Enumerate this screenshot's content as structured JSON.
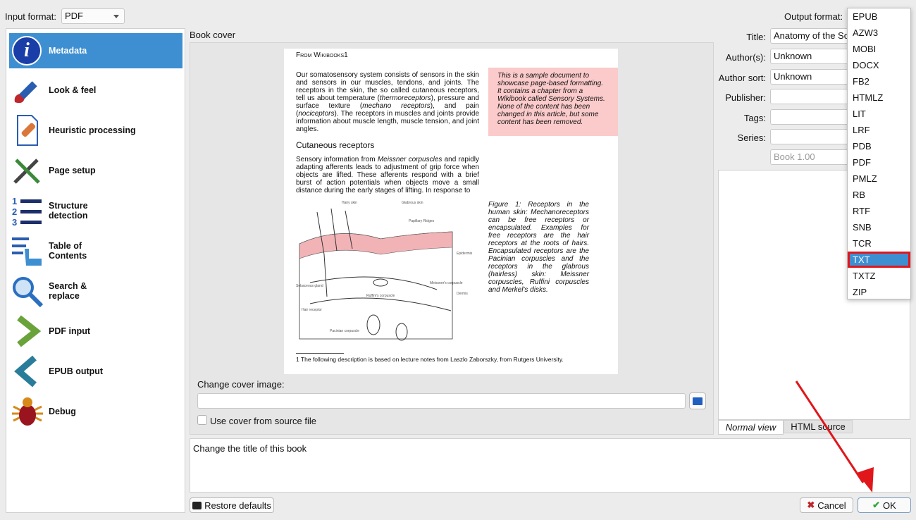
{
  "top": {
    "input_format_label": "Input format:",
    "input_format_value": "PDF",
    "output_format_label": "Output format:"
  },
  "sidebar": {
    "items": [
      {
        "label": "Metadata",
        "icon": "info-icon",
        "selected": true
      },
      {
        "label": "Look & feel",
        "icon": "paintbrush-icon"
      },
      {
        "label": "Heuristic processing",
        "icon": "bandage-document-icon"
      },
      {
        "label": "Page setup",
        "icon": "tools-icon"
      },
      {
        "label": "Structure detection",
        "icon": "numbered-list-icon"
      },
      {
        "label": "Table of Contents",
        "icon": "toc-hand-icon"
      },
      {
        "label": "Search & replace",
        "icon": "magnifier-icon"
      },
      {
        "label": "PDF input",
        "icon": "chevron-right-icon"
      },
      {
        "label": "EPUB output",
        "icon": "chevron-left-icon"
      },
      {
        "label": "Debug",
        "icon": "bug-icon"
      }
    ]
  },
  "cover": {
    "heading": "Book cover",
    "page": {
      "header": "From Wikibooks1",
      "para1_a": "Our somatosensory system consists of sensors in the skin and sensors in our muscles, tendons, and joints. The receptors in the skin, the so called cutaneous receptors, tell us about temperature (",
      "para1_i1": "thermoreceptors",
      "para1_b": "), pressure and surface texture (",
      "para1_i2": "mechano receptors",
      "para1_c": "), and pain (",
      "para1_i3": "nociceptors",
      "para1_d": "). The receptors in muscles and joints provide information about muscle length, muscle tension, and joint angles.",
      "note": "This is a sample document to showcase page-based formatting. It contains a chapter from a Wikibook called Sensory Systems. None of the content has been changed in this article, but some content has been removed.",
      "subheading": "Cutaneous receptors",
      "para2_a": "Sensory information from ",
      "para2_i": "Meissner corpuscles",
      "para2_b": " and rapidly adapting afferents leads to adjustment of grip force when objects are lifted. These afferents respond with a brief burst of action potentials when objects move a small distance during the early stages of lifting. In response to",
      "caption": "Figure 1: Receptors in the human skin: Mechanoreceptors can be free receptors or encapsulated. Examples for free receptors are the hair receptors at the roots of hairs. Encapsulated receptors are the Pacinian corpuscles and the receptors in the glabrous (hairless) skin: Meissner corpuscles, Ruffini corpuscles and Merkel's disks.",
      "figure_labels": {
        "hairy": "Hairy skin",
        "glabrous": "Glabrous skin",
        "papillary": "Papillary Ridges",
        "epidermis": "Epidermis",
        "dermis": "Dermis",
        "meissner": "Meissner's corpuscle",
        "ruffini": "Ruffini's corpuscle",
        "sebaceous": "Sebaceous gland",
        "hair_receptor": "Hair receptor",
        "pacinian": "Pacinian corpuscle"
      },
      "footnote": "1 The following description is based on lecture notes from Laszlo Zaborszky, from Rutgers University."
    },
    "change_label": "Change cover image:",
    "path_value": "",
    "use_source_label": "Use cover from source file",
    "use_source_checked": false
  },
  "meta": {
    "title_label": "Title:",
    "title_value": "Anatomy of the Somatosensory System",
    "authors_label": "Author(s):",
    "authors_value": "Unknown",
    "author_sort_label": "Author sort:",
    "author_sort_value": "Unknown",
    "publisher_label": "Publisher:",
    "publisher_value": "",
    "tags_label": "Tags:",
    "tags_value": "",
    "series_label": "Series:",
    "series_value": "",
    "series_index_placeholder": "Book 1.00"
  },
  "comments_tabs": {
    "normal": "Normal view",
    "html": "HTML source"
  },
  "help_text": "Change the title of this book",
  "buttons": {
    "restore": "Restore defaults",
    "cancel": "Cancel",
    "ok": "OK"
  },
  "output_formats": {
    "options": [
      "EPUB",
      "AZW3",
      "MOBI",
      "DOCX",
      "FB2",
      "HTMLZ",
      "LIT",
      "LRF",
      "PDB",
      "PDF",
      "PMLZ",
      "RB",
      "RTF",
      "SNB",
      "TCR",
      "TXT",
      "TXTZ",
      "ZIP"
    ],
    "selected": "TXT"
  },
  "colors": {
    "accent": "#3d8fd1",
    "annotation": "#e0161b",
    "note_bg": "#fbcaca"
  }
}
